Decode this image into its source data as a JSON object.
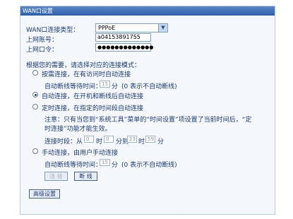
{
  "window": {
    "title": "WAN口设置"
  },
  "connection_type": {
    "label": "WAN口连接类型：",
    "value": "PPPoE"
  },
  "account": {
    "username_label": "上网账号：",
    "username_value": "a04153891755",
    "password_label": "上网口令：",
    "password_value": "●●●●●●●●●●●●●"
  },
  "prompt": "根据您的需要，请选择对应的连接模式：",
  "modes": {
    "on_demand": {
      "label": "按需连接，在有访问时自动连接",
      "checked": false,
      "idle_label": "自动断线等待时间：",
      "idle_value": "15",
      "idle_unit": "分",
      "idle_note": "(0 表示不自动断线)"
    },
    "auto": {
      "label": "自动连接，在开机和断线后自动连接",
      "checked": true
    },
    "scheduled": {
      "label": "定时连接，在指定的时间段自动连接",
      "checked": false,
      "note_line1": "注意：只有当您到“系统工具”菜单的“时间设置”项设置了当前时间后，“定",
      "note_line2": "时连接”功能才能生效。",
      "period_label": "连接时段：从",
      "from_hour": "0",
      "hour_unit": "时",
      "from_min": "0",
      "to_label": "分到",
      "to_hour": "23",
      "to_min": "59",
      "min_unit": "分"
    },
    "manual": {
      "label": "手动连接，由用户手动连接",
      "checked": false,
      "idle_label": "自动断线等待时间：",
      "idle_value": "15",
      "idle_unit": "分",
      "idle_note": "(0 表示不自动断线)"
    }
  },
  "buttons": {
    "connect": "连 接",
    "disconnect": "断 线",
    "advanced": "高级设置"
  },
  "colors": {
    "title_bar": "#2d5fab",
    "panel_bg": "#f4f8fd",
    "text": "#1e3a7a"
  }
}
